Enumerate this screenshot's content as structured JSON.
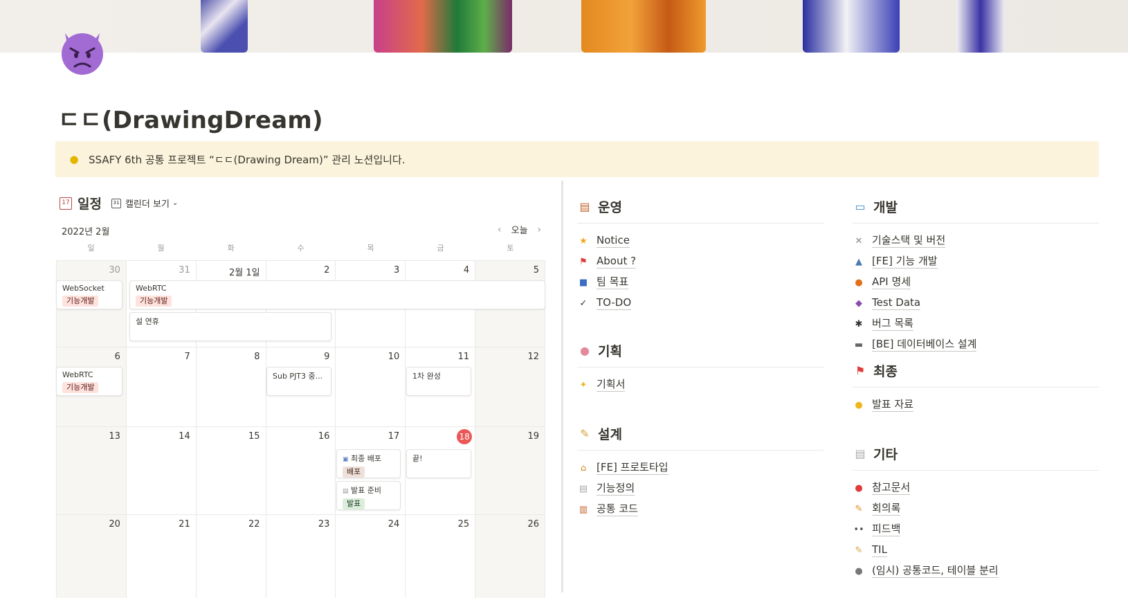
{
  "page": {
    "title": "ㄷㄷ(DrawingDream)",
    "icon": "smiling-devil-icon",
    "callout_icon": "light-bulb-icon",
    "callout_text": "SSAFY 6th 공통 프로젝트 “ㄷㄷ(Drawing Dream)” 관리 노션입니다."
  },
  "calendar": {
    "title": "일정",
    "view_label": "캘린더 보기",
    "month_label": "2022년 2월",
    "today_label": "오늘",
    "weekdays": [
      "일",
      "월",
      "화",
      "수",
      "목",
      "금",
      "토"
    ],
    "weeks": [
      [
        "30",
        "31",
        "2월 1일",
        "2",
        "3",
        "4",
        "5"
      ],
      [
        "6",
        "7",
        "8",
        "9",
        "10",
        "11",
        "12"
      ],
      [
        "13",
        "14",
        "15",
        "16",
        "17",
        "18",
        "19"
      ],
      [
        "20",
        "21",
        "22",
        "23",
        "24",
        "25",
        "26"
      ]
    ],
    "today": "18",
    "events": [
      {
        "title": "WebSocket",
        "tag": "기능개발"
      },
      {
        "title": "WebRTC",
        "tag": "기능개발"
      },
      {
        "title": "설 연휴",
        "tag": ""
      },
      {
        "title": "WebRTC",
        "tag": "기능개발"
      },
      {
        "title": "Sub PJT3 중...",
        "tag": ""
      },
      {
        "title": "1차 완성",
        "tag": ""
      },
      {
        "title": "최종 배포",
        "tag": "배포"
      },
      {
        "title": "발표 준비",
        "tag": "발표"
      },
      {
        "title": "끝!",
        "tag": ""
      }
    ]
  },
  "sections": {
    "ops": {
      "title": "운영",
      "icon": "books-icon",
      "items": [
        {
          "label": "Notice",
          "icon": "star-icon"
        },
        {
          "label": "About ?",
          "icon": "red-flag-icon"
        },
        {
          "label": "팀 목표",
          "icon": "car-icon"
        },
        {
          "label": "TO-DO",
          "icon": "check-icon"
        }
      ]
    },
    "plan": {
      "title": "기획",
      "icon": "brain-icon",
      "items": [
        {
          "label": "기획서",
          "icon": "dizzy-icon"
        }
      ]
    },
    "design": {
      "title": "설계",
      "icon": "memo-icon",
      "items": [
        {
          "label": "[FE] 프로토타입",
          "icon": "house-icon"
        },
        {
          "label": "기능정의",
          "icon": "page-icon"
        },
        {
          "label": "공통 코드",
          "icon": "ledger-icon"
        }
      ]
    },
    "dev": {
      "title": "개발",
      "icon": "laptop-icon",
      "items": [
        {
          "label": "기술스택 및 버전",
          "icon": "tools-icon"
        },
        {
          "label": "[FE] 기능 개발",
          "icon": "ship-icon"
        },
        {
          "label": "API 명세",
          "icon": "pumpkin-icon"
        },
        {
          "label": "Test Data",
          "icon": "alien-monster-icon"
        },
        {
          "label": "버그 목록",
          "icon": "spider-icon"
        },
        {
          "label": "[BE] 데이터베이스 설계",
          "icon": "keyboard-icon"
        }
      ]
    },
    "final": {
      "title": "최종",
      "icon": "red-flag-icon",
      "items": [
        {
          "label": "발표 자료",
          "icon": "sunglasses-face-icon"
        }
      ]
    },
    "etc": {
      "title": "기타",
      "icon": "page-icon",
      "items": [
        {
          "label": "참고문서",
          "icon": "pushpin-icon"
        },
        {
          "label": "회의록",
          "icon": "pencil-icon"
        },
        {
          "label": "피드백",
          "icon": "eyes-icon"
        },
        {
          "label": "TIL",
          "icon": "memo-icon"
        },
        {
          "label": "(임시) 공통코드, 테이블 분리",
          "icon": "alien-icon"
        }
      ]
    }
  }
}
